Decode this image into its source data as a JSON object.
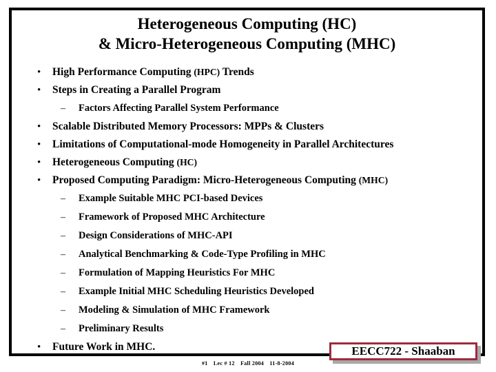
{
  "slide": {
    "title_lines": [
      "Heterogeneous Computing (HC)",
      "& Micro-Heterogeneous Computing (MHC)"
    ],
    "markers": {
      "level1": "•",
      "level2": "–"
    },
    "outline": [
      {
        "level": 1,
        "text": "High Performance Computing ",
        "small": "(HPC)",
        "tail": " Trends"
      },
      {
        "level": 1,
        "text": "Steps in Creating a Parallel Program",
        "small": "",
        "tail": ""
      },
      {
        "level": 2,
        "text": "Factors Affecting Parallel System Performance",
        "small": "",
        "tail": ""
      },
      {
        "level": 1,
        "text": "Scalable Distributed Memory Processors: MPPs & Clusters",
        "small": "",
        "tail": ""
      },
      {
        "level": 1,
        "text": "Limitations of Computational-mode Homogeneity in Parallel Architectures",
        "small": "",
        "tail": ""
      },
      {
        "level": 1,
        "text": "Heterogeneous Computing ",
        "small": "(HC)",
        "tail": ""
      },
      {
        "level": 1,
        "text": "Proposed Computing Paradigm:  Micro-Heterogeneous Computing ",
        "small": "(MHC)",
        "tail": ""
      },
      {
        "level": 2,
        "text": "Example Suitable MHC PCI-based Devices",
        "small": "",
        "tail": ""
      },
      {
        "level": 2,
        "text": "Framework of Proposed MHC Architecture",
        "small": "",
        "tail": ""
      },
      {
        "level": 2,
        "text": "Design Considerations of MHC-API",
        "small": "",
        "tail": ""
      },
      {
        "level": 2,
        "text": "Analytical Benchmarking & Code-Type Profiling in MHC",
        "small": "",
        "tail": ""
      },
      {
        "level": 2,
        "text": "Formulation of Mapping Heuristics For MHC",
        "small": "",
        "tail": ""
      },
      {
        "level": 2,
        "text": "Example Initial MHC Scheduling Heuristics Developed",
        "small": "",
        "tail": ""
      },
      {
        "level": 2,
        "text": "Modeling & Simulation of MHC Framework",
        "small": "",
        "tail": ""
      },
      {
        "level": 2,
        "text": "Preliminary Results",
        "small": "",
        "tail": ""
      },
      {
        "level": 1,
        "text": "Future Work in MHC",
        "small": "",
        "tail": "."
      }
    ],
    "footer": {
      "slide_number": "#1",
      "lecture": "Lec # 12",
      "term": "Fall 2004",
      "date": "11-8-2004"
    },
    "badge": {
      "text": "EECC722 - Shaaban",
      "border_color": "#9e2a3c",
      "shadow_color": "#a8a8a8",
      "background_color": "#ffffff"
    }
  }
}
